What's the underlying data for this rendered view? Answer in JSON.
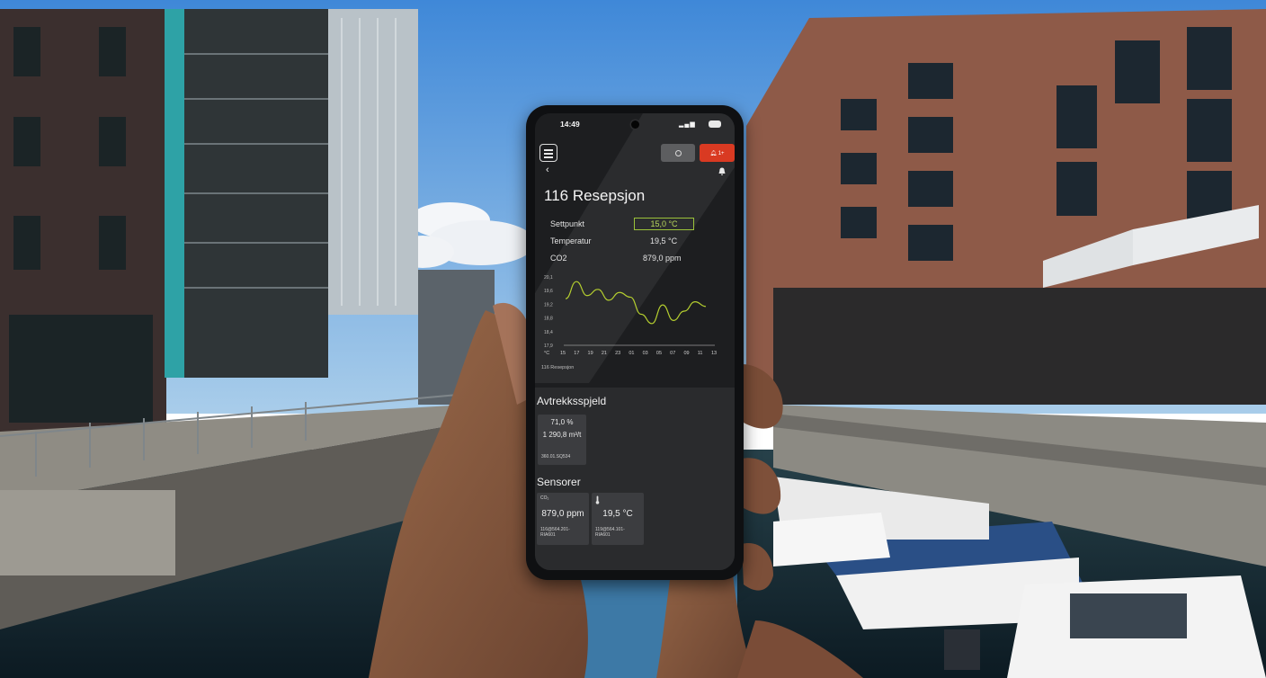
{
  "phone": {
    "status_bar": {
      "time": "14:49",
      "battery": ""
    },
    "room": {
      "title": "116 Resepsjon"
    },
    "readings": [
      {
        "label": "Settpunkt",
        "value": "15,0 °C"
      },
      {
        "label": "Temperatur",
        "value": "19,5 °C"
      },
      {
        "label": "CO2",
        "value": "879,0 ppm"
      }
    ],
    "chart_data": {
      "type": "line",
      "x": [
        "15",
        "17",
        "19",
        "21",
        "23",
        "01",
        "03",
        "05",
        "07",
        "09",
        "11",
        "13"
      ],
      "x_unit_label": "°C",
      "y_ticks": [
        "20,1",
        "19,6",
        "19,2",
        "18,8",
        "18,4",
        "17,9"
      ],
      "ylim": [
        17.9,
        20.1
      ],
      "series": [
        {
          "values": [
            19.4,
            19.95,
            19.5,
            19.7,
            19.35,
            19.6,
            19.45,
            18.9,
            18.6,
            19.2,
            18.7,
            19.0,
            19.3,
            19.15
          ]
        }
      ],
      "line_color": "#b5cf2f",
      "caption": "116 Resepsjon"
    },
    "exhaust": {
      "title": "Avtrekksspjeld",
      "percent": "71,0 %",
      "flow": "1 290,8 m³/t",
      "id": "360.01.SQ534"
    },
    "sensors": {
      "title": "Sensorer",
      "items": [
        {
          "head": "CO₂",
          "value": "879,0 ppm",
          "id_line1": "116@564.201-",
          "id_line2": "RIA601",
          "icon": "co2-label"
        },
        {
          "head": "",
          "value": "19,5 °C",
          "id_line1": "119@564.101-",
          "id_line2": "RIA601",
          "icon": "thermometer-icon"
        }
      ]
    }
  }
}
